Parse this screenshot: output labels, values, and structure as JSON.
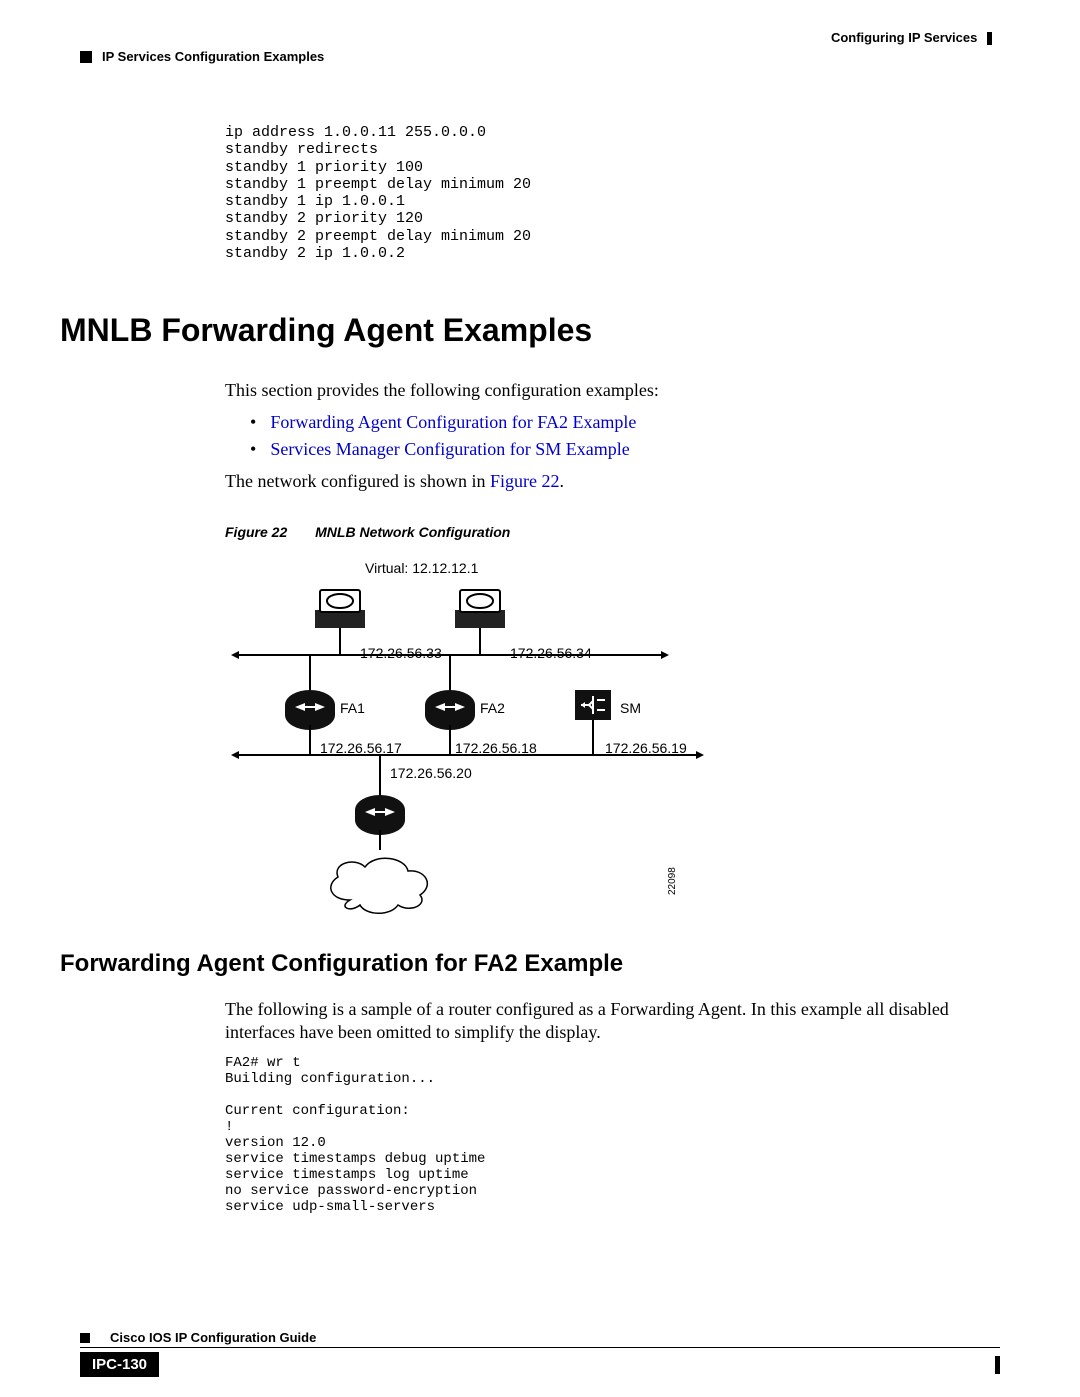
{
  "header": {
    "chapter_title": "Configuring IP Services",
    "section_title": "IP Services Configuration Examples"
  },
  "code1": "ip address 1.0.0.11 255.0.0.0\nstandby redirects\nstandby 1 priority 100\nstandby 1 preempt delay minimum 20\nstandby 1 ip 1.0.0.1\nstandby 2 priority 120\nstandby 2 preempt delay minimum 20\nstandby 2 ip 1.0.0.2",
  "sections": {
    "mnlb_heading": "MNLB Forwarding Agent Examples",
    "intro_text": "This section provides the following configuration examples:",
    "bullets": {
      "b1": "Forwarding Agent Configuration for FA2 Example",
      "b2": "Services Manager Configuration for SM Example"
    },
    "network_text_pre": "The network configured is shown in ",
    "network_text_link": "Figure 22",
    "network_text_post": "."
  },
  "figure": {
    "label": "Figure 22",
    "title": "MNLB Network Configuration",
    "virtual_label": "Virtual: 12.12.12.1",
    "ip_top_left": "172.26.56.33",
    "ip_top_right": "172.26.56.34",
    "fa1": "FA1",
    "fa2": "FA2",
    "sm": "SM",
    "ip_mid_1": "172.26.56.17",
    "ip_mid_2": "172.26.56.18",
    "ip_mid_3": "172.26.56.19",
    "ip_below": "172.26.56.20",
    "diagram_id": "22098"
  },
  "fa2": {
    "heading": "Forwarding Agent Configuration for FA2 Example",
    "text": "The following is a sample of a router configured as a Forwarding Agent. In this example all disabled interfaces have been omitted to simplify the display.",
    "code": "FA2# wr t\nBuilding configuration...\n\nCurrent configuration:\n!\nversion 12.0\nservice timestamps debug uptime\nservice timestamps log uptime\nno service password-encryption\nservice udp-small-servers"
  },
  "footer": {
    "guide_title": "Cisco IOS IP Configuration Guide",
    "page_number": "IPC-130"
  }
}
